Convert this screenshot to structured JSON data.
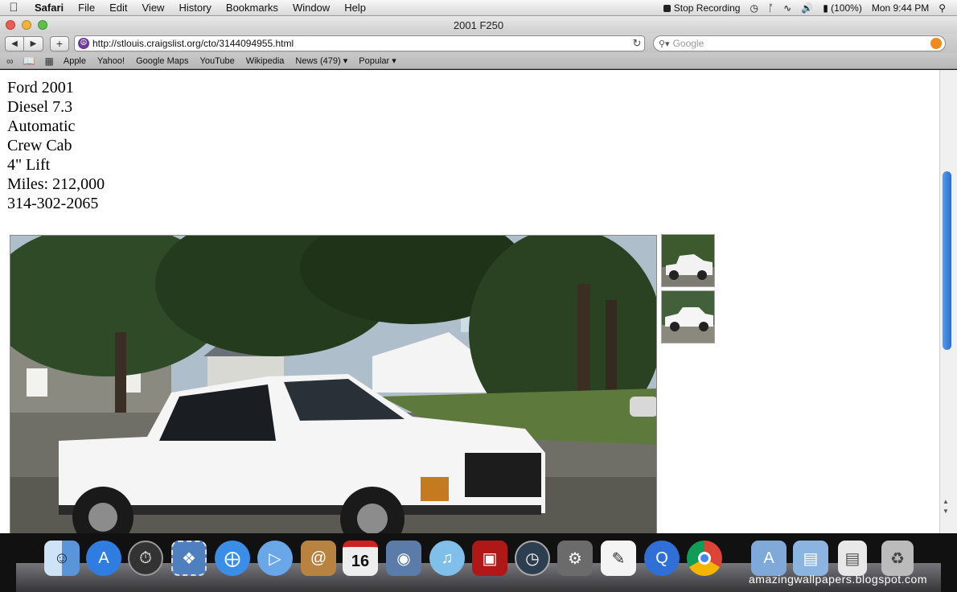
{
  "menubar": {
    "app": "Safari",
    "items": [
      "File",
      "Edit",
      "View",
      "History",
      "Bookmarks",
      "Window",
      "Help"
    ],
    "stop_recording": "Stop Recording",
    "battery": "(100%)",
    "clock": "Mon 9:44 PM"
  },
  "window": {
    "title": "2001 F250"
  },
  "toolbar": {
    "url": "http://stlouis.craigslist.org/cto/3144094955.html",
    "search_placeholder": "Google"
  },
  "bookmarks": [
    "Apple",
    "Yahoo!",
    "Google Maps",
    "YouTube",
    "Wikipedia",
    "News (479) ▾",
    "Popular ▾"
  ],
  "listing": {
    "lines": [
      "Ford 2001",
      "Diesel 7.3",
      "Automatic",
      "Crew Cab",
      "4\" Lift",
      "Miles: 212,000",
      "314-302-2065"
    ]
  },
  "dock": {
    "icons": [
      "finder-icon",
      "app-store-icon",
      "dashboard-icon",
      "mail-stamp-icon",
      "safari-icon",
      "facetime-icon",
      "address-book-icon",
      "calendar-icon",
      "iphoto-icon",
      "itunes-icon",
      "photo-booth-icon",
      "time-machine-icon",
      "system-preferences-icon",
      "textedit-icon",
      "quicktime-icon",
      "chrome-icon",
      "applications-folder-icon",
      "documents-folder-icon",
      "file-icon",
      "trash-icon"
    ],
    "calendar_day": "16",
    "colors": [
      "#6aa0e0",
      "#2f7de0",
      "#333333",
      "#4f7fbf",
      "#3a8ee8",
      "#6aa7e8",
      "#b88340",
      "#eeeeee",
      "#5b7ca8",
      "#7fbfea",
      "#b01818",
      "#2c3e50",
      "#6b6b6b",
      "#f4f4f4",
      "#2f6fd6",
      "#f1f1f1",
      "#7fa9d9",
      "#8cb4e0",
      "#e8e8e8",
      "#bbbbbb"
    ]
  },
  "watermark": "amazingwallpapers.blogspot.com"
}
